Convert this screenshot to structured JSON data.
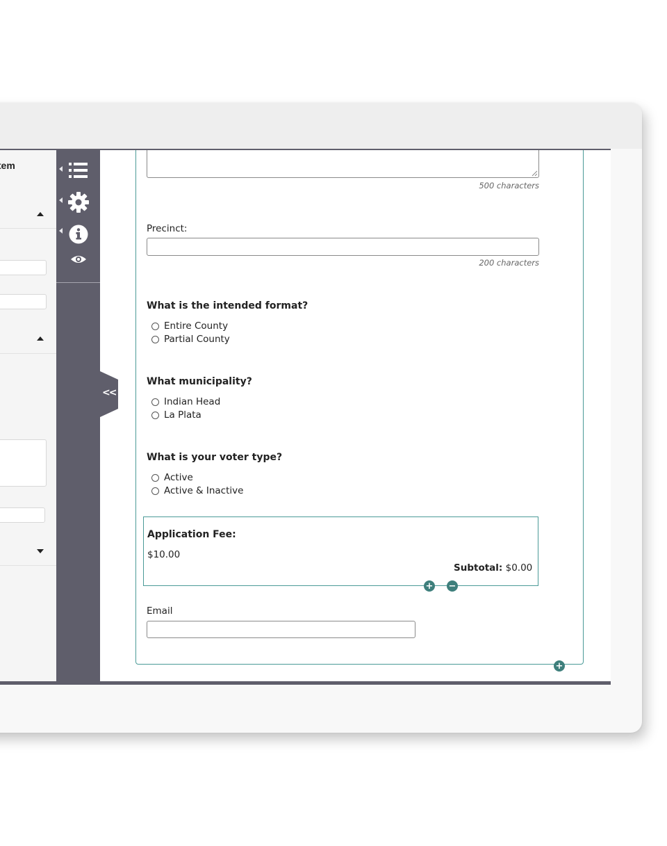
{
  "left_panel": {
    "title": "Item"
  },
  "sidebar_icons": [
    "list-icon",
    "gear-icon",
    "info-icon",
    "eye-icon"
  ],
  "collapse_label": "<<",
  "form": {
    "comment_hint": "500 characters",
    "precinct_label": "Precinct:",
    "precinct_hint": "200 characters",
    "format_question": "What is the intended format?",
    "format_options": [
      "Entire County",
      "Partial County"
    ],
    "municipality_question": "What municipality?",
    "municipality_options": [
      "Indian Head",
      "La Plata"
    ],
    "voter_question": "What is your voter type?",
    "voter_options": [
      "Active",
      "Active & Inactive"
    ],
    "fee_label": "Application Fee:",
    "fee_amount": "$10.00",
    "subtotal_label": "Subtotal:",
    "subtotal_value": "$0.00",
    "email_label": "Email"
  },
  "colors": {
    "sidebar": "#5f5e6b",
    "accent": "#3e7f7c",
    "border_teal": "#4a9a97"
  }
}
